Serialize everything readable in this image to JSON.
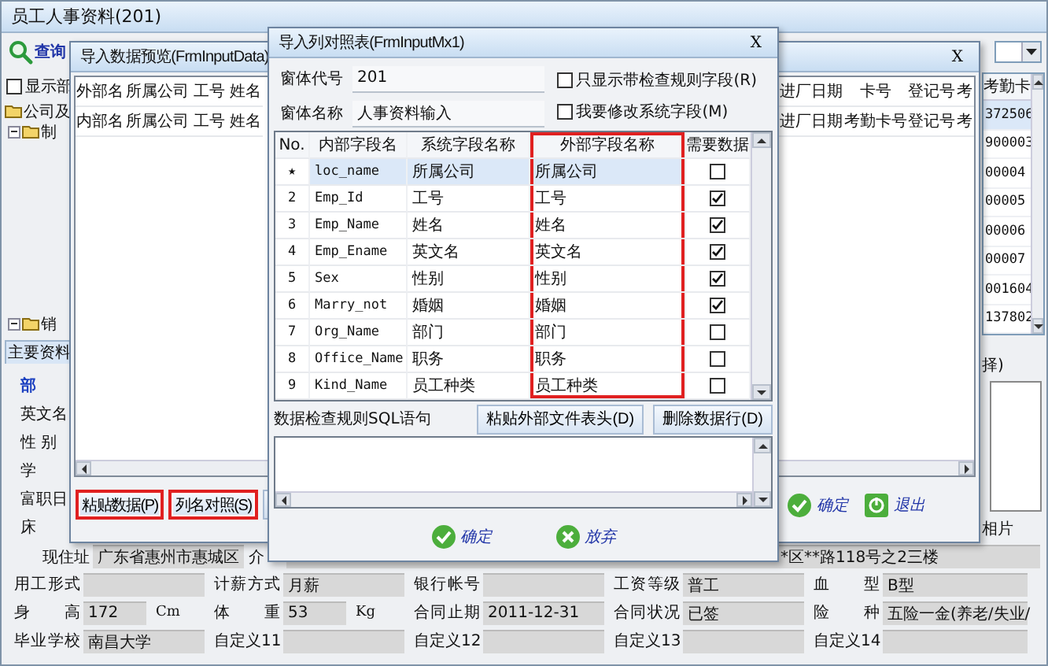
{
  "main_window": {
    "title": "员工人事资料(201)",
    "search_button": "查询",
    "show_dept": {
      "label": "显示部",
      "checked": false
    },
    "tree": [
      {
        "label": "公司及",
        "children": [
          {
            "label": "制",
            "expanded": true
          },
          {
            "label": "销",
            "expanded": true
          }
        ]
      }
    ],
    "tab": {
      "label": "主要资料",
      "selected": true
    },
    "field_labels": [
      {
        "label": "部",
        "emphasis": true
      },
      {
        "label": "英文名",
        "emphasis": false
      },
      {
        "label": "性 别",
        "emphasis": false
      },
      {
        "label": "学",
        "emphasis": false
      },
      {
        "label": "富职日",
        "emphasis": false
      },
      {
        "label": "床",
        "emphasis": false
      }
    ],
    "card_column": {
      "header": "考勤卡",
      "rows": [
        {
          "value": "372506",
          "selected": true
        },
        {
          "value": "900003",
          "selected": false
        },
        {
          "value": "00004",
          "selected": false
        },
        {
          "value": "00005",
          "selected": false
        },
        {
          "value": "00006",
          "selected": false
        },
        {
          "value": "00007",
          "selected": false
        },
        {
          "value": "001604",
          "selected": false
        },
        {
          "value": "137802",
          "selected": false
        }
      ]
    },
    "photo": {
      "hint": "择)",
      "label": "相片"
    },
    "address": {
      "label": "现住址",
      "value": "广东省惠州市惠城区",
      "intro_label": "介",
      "intro_value": "*区**路118号之2三楼"
    },
    "form_rows": [
      {
        "fields": [
          {
            "label": "用工形式"
          },
          {
            "label": "计薪方式",
            "value": "月薪"
          },
          {
            "label": "银行帐号"
          },
          {
            "label": "工资等级",
            "value": "普工"
          },
          {
            "label": "血 型",
            "value": "B型"
          }
        ]
      },
      {
        "fields": [
          {
            "label": "身 高",
            "value": "172",
            "unit": "Cm"
          },
          {
            "label": "体 重",
            "value": "53",
            "unit": "Kg"
          },
          {
            "label": "合同止期",
            "value": "2011-12-31"
          },
          {
            "label": "合同状况",
            "value": "已签"
          },
          {
            "label": "险 种",
            "value": "五险一金(养老/失业/"
          }
        ]
      },
      {
        "fields": [
          {
            "label": "毕业学校",
            "value": "南昌大学"
          },
          {
            "label": "自定义11"
          },
          {
            "label": "自定义12"
          },
          {
            "label": "自定义13"
          },
          {
            "label": "自定义14"
          }
        ]
      }
    ]
  },
  "preview_dialog": {
    "title": "导入数据预览(FrmInputData)",
    "close": "X",
    "header_rows": [
      {
        "label": "外部名",
        "left": [
          "所属公司",
          "工号",
          "姓名"
        ],
        "right": [
          "进厂日期",
          "卡号",
          "登记号",
          "考"
        ]
      },
      {
        "label": "内部名",
        "left": [
          "所属公司",
          "工号",
          "姓名"
        ],
        "right": [
          "进厂日期",
          "考勤卡号",
          "登记号",
          "考"
        ]
      }
    ],
    "buttons": [
      {
        "label": "粘贴数据(P)",
        "highlighted": true
      },
      {
        "label": "列名对照(S)",
        "highlighted": true
      },
      {
        "highlighted": false
      }
    ],
    "actions": [
      {
        "kind": "ok",
        "label": "确定"
      },
      {
        "kind": "exit",
        "label": "退出"
      }
    ]
  },
  "mapping_dialog": {
    "title": "导入列对照表(FrmInputMx1)",
    "close": "X",
    "form_code": {
      "label": "窗体代号",
      "value": "201"
    },
    "form_name": {
      "label": "窗体名称",
      "value": "人事资料输入"
    },
    "options": [
      {
        "label": "只显示带检查规则字段(R)",
        "checked": false
      },
      {
        "label": "我要修改系统字段(M)",
        "checked": false
      }
    ],
    "columns": [
      {
        "label": "No.",
        "highlighted": false
      },
      {
        "label": "内部字段名",
        "highlighted": false
      },
      {
        "label": "系统字段名称",
        "highlighted": false
      },
      {
        "label": "外部字段名称",
        "highlighted": true
      },
      {
        "label": "需要数据",
        "highlighted": false
      }
    ],
    "rows": [
      {
        "no": "★",
        "internal": "loc_name",
        "system": "所属公司",
        "external": "所属公司",
        "required": false,
        "selected": true
      },
      {
        "no": "2",
        "internal": "Emp_Id",
        "system": "工号",
        "external": "工号",
        "required": true,
        "selected": false
      },
      {
        "no": "3",
        "internal": "Emp_Name",
        "system": "姓名",
        "external": "姓名",
        "required": true,
        "selected": false
      },
      {
        "no": "4",
        "internal": "Emp_Ename",
        "system": "英文名",
        "external": "英文名",
        "required": true,
        "selected": false
      },
      {
        "no": "5",
        "internal": "Sex",
        "system": "性别",
        "external": "性别",
        "required": true,
        "selected": false
      },
      {
        "no": "6",
        "internal": "Marry_not",
        "system": "婚姻",
        "external": "婚姻",
        "required": true,
        "selected": false
      },
      {
        "no": "7",
        "internal": "Org_Name",
        "system": "部门",
        "external": "部门",
        "required": false,
        "selected": false
      },
      {
        "no": "8",
        "internal": "Office_Name",
        "system": "职务",
        "external": "职务",
        "required": false,
        "selected": false
      },
      {
        "no": "9",
        "internal": "Kind_Name",
        "system": "员工种类",
        "external": "员工种类",
        "required": false,
        "selected": false
      }
    ],
    "sql_label": "数据检查规则SQL语句",
    "sql_buttons": [
      "粘贴外部文件表头(D)",
      "删除数据行(D)"
    ],
    "actions": [
      {
        "kind": "ok",
        "label": "确定"
      },
      {
        "kind": "cancel",
        "label": "放弃"
      }
    ]
  }
}
